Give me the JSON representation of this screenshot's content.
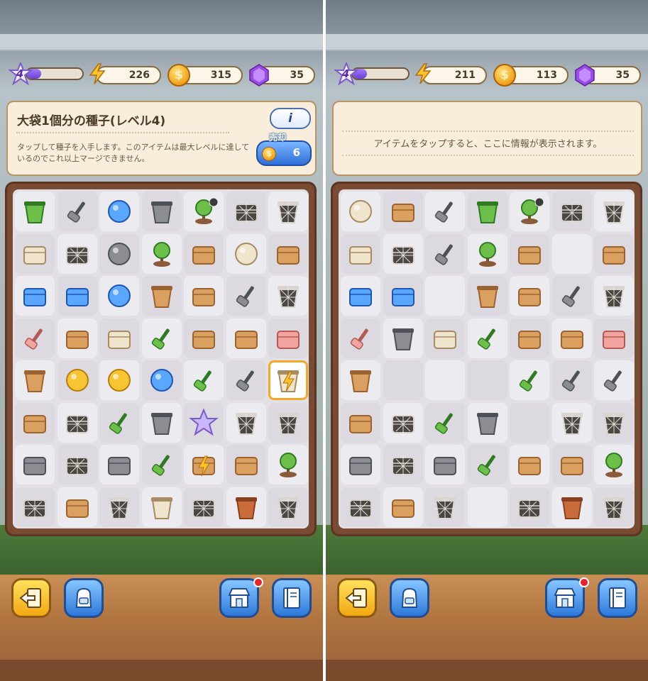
{
  "left": {
    "level": "4",
    "xp_fraction": 0.25,
    "energy": "226",
    "coins": "315",
    "gems": "35",
    "info": {
      "title": "大袋1個分の種子(レベル4)",
      "description": "タップして種子を入手します。このアイテムは最大レベルに達しているのでこれ以上マージできません。",
      "info_button": "i",
      "sell_label": "売却",
      "sell_price": "6"
    },
    "board": [
      [
        "hourglass-icon",
        "wrench-icon",
        "energy-orb-blue-icon",
        "lantern-icon",
        "tree-timer-icon",
        "cobweb-plank-icon",
        "cobweb-pot-icon"
      ],
      [
        "cloth-icon",
        "cobweb-basket-icon",
        "crystal-icon",
        "twig-icon",
        "wood-plank-icon",
        "lightbulb-icon",
        "bean-icon"
      ],
      [
        "paint-tube-icon",
        "treasure-chest-icon",
        "energy-orb-green-icon",
        "wood-bowl-icon",
        "logs-icon",
        "wrench-large-icon",
        "cobweb-pot-icon"
      ],
      [
        "broom-icon",
        "hand-bell-icon",
        "glove-icon",
        "trowel-icon",
        "scoop-icon",
        "wood-sticks-icon",
        "sponge-icon"
      ],
      [
        "vase-icon",
        "gold-coins-icon",
        "gold-coins-icon",
        "energy-small-icon",
        "pruner-icon",
        "scraper-icon",
        "seed-sack-bolt-icon"
      ],
      [
        "toolbox-icon",
        "cobweb-basket-icon",
        "fork-icon",
        "bucket-tools-icon",
        "star-icon",
        "cobweb-pot-icon",
        "cobweb-pot-icon"
      ],
      [
        "greenhouse-icon",
        "cobweb-stones-icon",
        "stones-icon",
        "rake-icon",
        "toolbox-bolt-icon",
        "wood-crate-icon",
        "bonsai-icon"
      ],
      [
        "cobweb-crate-icon",
        "cardboard-box-icon",
        "cobweb-pot-icon",
        "seed-sack-icon",
        "cobweb-rock-icon",
        "clay-pot-icon",
        "cobweb-bucket-icon"
      ]
    ]
  },
  "right": {
    "level": "4",
    "xp_fraction": 0.25,
    "energy": "211",
    "coins": "113",
    "gems": "35",
    "info": {
      "message": "アイテムをタップすると、ここに情報が表示されます。"
    },
    "board": [
      [
        "lightbulb-icon",
        "hand-bell-icon",
        "nails-icon",
        "plant-pot-icon",
        "tree-timer-icon",
        "cobweb-plank-icon",
        "cobweb-pot-icon"
      ],
      [
        "cloth-icon",
        "cobweb-basket-icon",
        "wrench-icon",
        "twig-icon",
        "wood-plank-icon",
        "",
        "bean-icon"
      ],
      [
        "paint-tube-icon",
        "treasure-chest-icon",
        "",
        "wood-bowl-icon",
        "logs-icon",
        "wrench-large-icon",
        "cobweb-pot-icon"
      ],
      [
        "broom-icon",
        "lantern-icon",
        "glove-icon",
        "trowel-icon",
        "scoop-icon",
        "wood-sticks-icon",
        "sponge-icon"
      ],
      [
        "vase-icon",
        "",
        "",
        "",
        "pruner-icon",
        "paintbrush-icon",
        "mallet-icon"
      ],
      [
        "toolbox-icon",
        "cobweb-basket-icon",
        "fork-icon",
        "bucket-tools-icon",
        "",
        "cobweb-pot-icon",
        "cobweb-pot-icon"
      ],
      [
        "greenhouse-icon",
        "cobweb-stones-icon",
        "stones-icon",
        "rake-icon",
        "flower-crate-icon",
        "wood-crate-icon",
        "bonsai-icon"
      ],
      [
        "cobweb-crate-icon",
        "cardboard-box-icon",
        "cobweb-pot-icon",
        "",
        "cobweb-rock-icon",
        "clay-pot-icon",
        "cobweb-bucket-icon"
      ]
    ]
  },
  "bottom_buttons": [
    "exit-icon",
    "backpack-icon",
    "shop-icon",
    "journal-icon"
  ],
  "colors": {
    "accent_selected": "#f3a925",
    "panel": "#f8eedb",
    "board_frame": "#7a4b33",
    "button_blue": "#2e79d9",
    "button_yellow": "#f2a813"
  }
}
